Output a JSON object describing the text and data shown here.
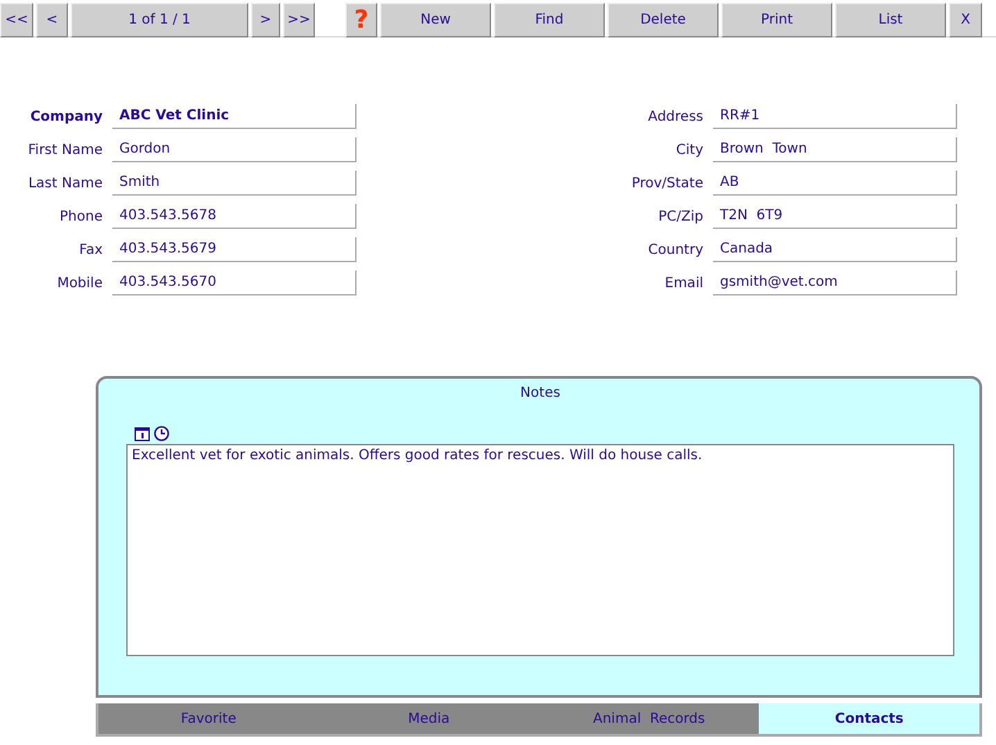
{
  "toolbar": {
    "first": "<<",
    "previous": "<",
    "record": "1 of 1 / 1",
    "next": ">",
    "last": ">>",
    "help": "?",
    "actions": [
      "New",
      "Find",
      "Delete",
      "Print",
      "List"
    ],
    "close": "X"
  },
  "left_fields": [
    {
      "label": "Company",
      "value": "ABC Vet Clinic",
      "emphasis": true
    },
    {
      "label": "First Name",
      "value": "Gordon",
      "emphasis": false
    },
    {
      "label": "Last Name",
      "value": "Smith",
      "emphasis": false
    },
    {
      "label": "Phone",
      "value": "403.543.5678",
      "emphasis": false
    },
    {
      "label": "Fax",
      "value": "403.543.5679",
      "emphasis": false
    },
    {
      "label": "Mobile",
      "value": "403.543.5670",
      "emphasis": false
    }
  ],
  "right_fields": [
    {
      "label": "Address",
      "value": "RR#1",
      "emphasis": false
    },
    {
      "label": "City",
      "value": "Brown  Town",
      "emphasis": false
    },
    {
      "label": "Prov/State",
      "value": "AB",
      "emphasis": false
    },
    {
      "label": "PC/Zip",
      "value": "T2N  6T9",
      "emphasis": false
    },
    {
      "label": "Country",
      "value": "Canada",
      "emphasis": false
    },
    {
      "label": "Email",
      "value": "gsmith@vet.com",
      "emphasis": false
    }
  ],
  "notes": {
    "title": "Notes",
    "text": "Excellent vet for exotic animals. Offers good rates for rescues. Will do house calls."
  },
  "tabs": [
    {
      "label": "Favorite",
      "selected": false
    },
    {
      "label": "Media",
      "selected": false
    },
    {
      "label": "Animal  Records",
      "selected": false
    },
    {
      "label": "Contacts",
      "selected": true
    }
  ]
}
